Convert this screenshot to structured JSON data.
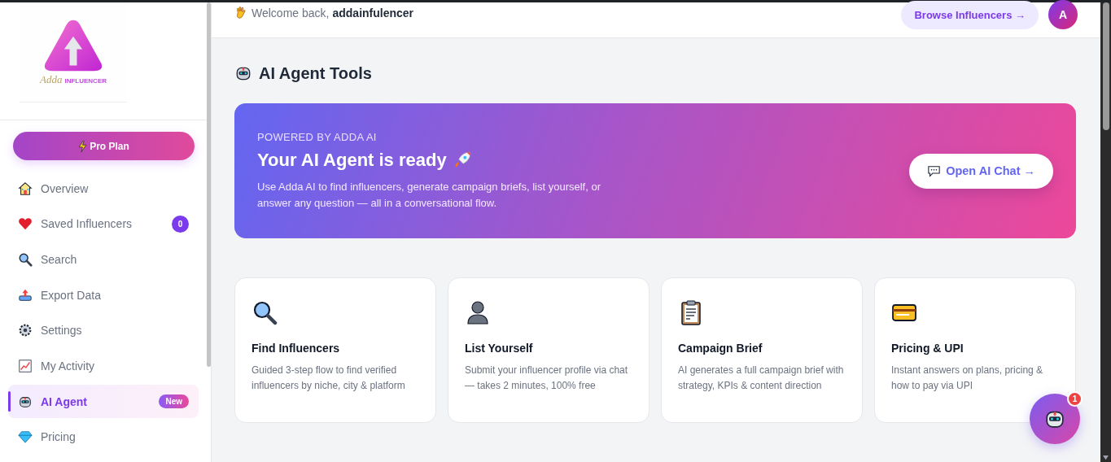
{
  "sidebar": {
    "logo": {
      "script": "Adda",
      "wordmark": "INFLUENCER"
    },
    "plan_button": "Pro Plan",
    "items": [
      {
        "label": "Overview",
        "selected": false
      },
      {
        "label": "Saved Influencers",
        "selected": false,
        "badge": {
          "kind": "count",
          "text": "0"
        }
      },
      {
        "label": "Search",
        "selected": false
      },
      {
        "label": "Export Data",
        "selected": false
      },
      {
        "label": "Settings",
        "selected": false
      },
      {
        "label": "My Activity",
        "selected": false
      },
      {
        "label": "AI Agent",
        "selected": true,
        "badge": {
          "kind": "pill",
          "text": "New"
        }
      },
      {
        "label": "Pricing",
        "selected": false
      }
    ]
  },
  "header": {
    "greeting": "Welcome back,",
    "username": "addainfulencer",
    "browse_button": "Browse Influencers →",
    "avatar": "A"
  },
  "page_title": "AI Agent Tools",
  "hero": {
    "eyebrow": "POWERED BY ADDA AI",
    "title": "Your AI Agent is ready",
    "description": "Use Adda AI to find influencers, generate campaign briefs, list yourself, or answer any question — all in a conversational flow.",
    "button": "Open AI Chat →"
  },
  "cards": [
    {
      "title": "Find Influencers",
      "description": "Guided 3-step flow to find verified influencers by niche, city & platform"
    },
    {
      "title": "List Yourself",
      "description": "Submit your influencer profile via chat — takes 2 minutes, 100% free"
    },
    {
      "title": "Campaign Brief",
      "description": "AI generates a full campaign brief with strategy, KPIs & content direction"
    },
    {
      "title": "Pricing & UPI",
      "description": "Instant answers on plans, pricing & how to pay via UPI"
    }
  ],
  "chat_fab": {
    "badge": "1"
  }
}
